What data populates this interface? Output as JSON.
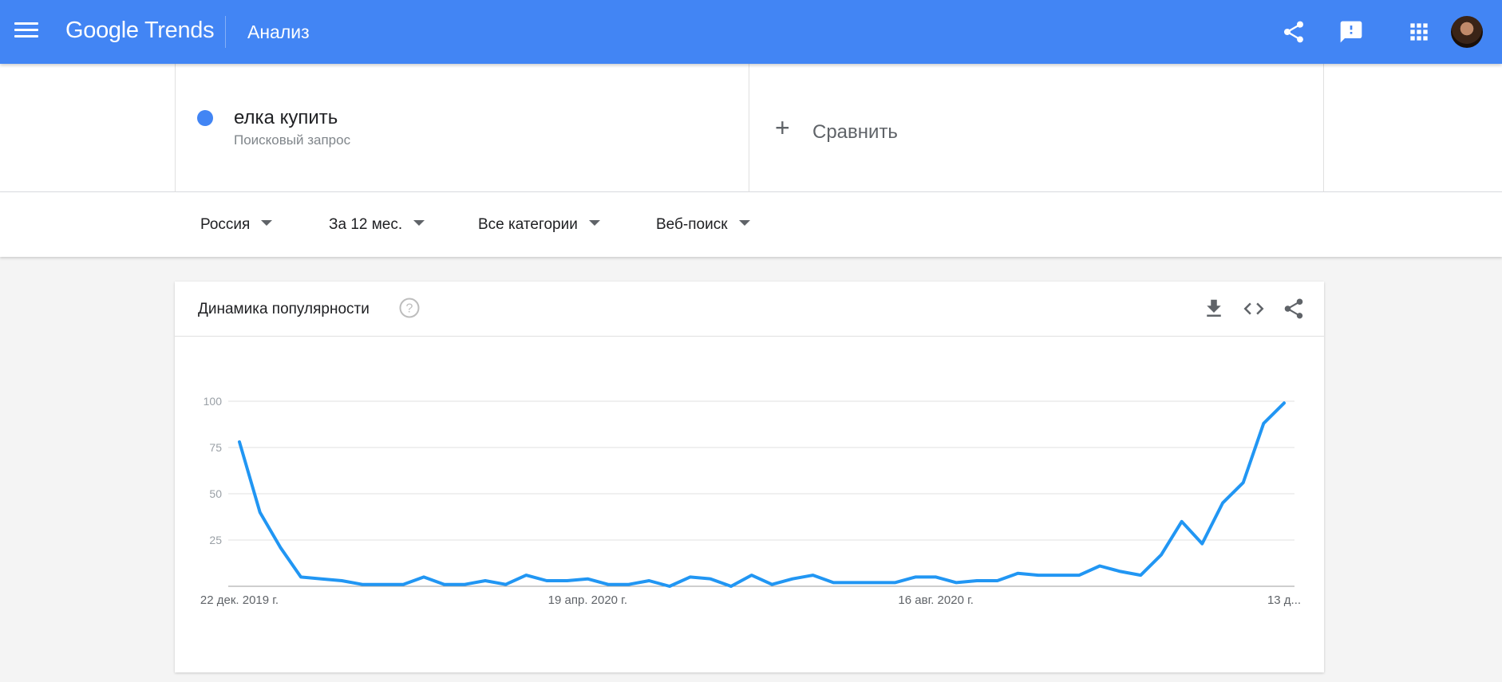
{
  "header": {
    "logo_brand": "Google",
    "logo_product": "Trends",
    "page_title": "Анализ",
    "icons": [
      "menu-icon",
      "share-icon",
      "feedback-icon",
      "apps-icon",
      "avatar"
    ]
  },
  "search": {
    "term": "елка купить",
    "term_type": "Поисковый запрос",
    "term_color": "#4285f4",
    "compare_label": "Сравнить"
  },
  "filters": {
    "geo": "Россия",
    "time": "За 12 мес.",
    "category": "Все категории",
    "property": "Веб-поиск"
  },
  "card": {
    "title": "Динамика популярности"
  },
  "chart_data": {
    "type": "line",
    "title": "",
    "xlabel": "",
    "ylabel": "",
    "ylim": [
      0,
      100
    ],
    "yticks": [
      "100",
      "75",
      "50",
      "25"
    ],
    "xtick_labels": [
      "22 дек. 2019 г.",
      "19 апр. 2020 г.",
      "16 авг. 2020 г.",
      "13 д..."
    ],
    "xtick_indices": [
      0,
      17,
      34,
      51
    ],
    "grid": true,
    "series": [
      {
        "color": "#2196f3",
        "values": [
          78,
          40,
          21,
          5,
          4,
          3,
          1,
          1,
          1,
          5,
          1,
          1,
          3,
          1,
          6,
          3,
          3,
          4,
          1,
          1,
          3,
          0,
          5,
          4,
          0,
          6,
          1,
          4,
          6,
          2,
          2,
          2,
          2,
          5,
          5,
          2,
          3,
          3,
          7,
          6,
          6,
          6,
          11,
          8,
          6,
          17,
          35,
          23,
          45,
          56,
          88,
          99
        ]
      }
    ]
  }
}
